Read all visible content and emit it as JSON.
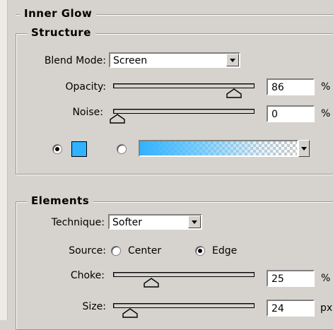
{
  "inner_glow": {
    "title": "Inner Glow",
    "structure": {
      "title": "Structure",
      "blend_mode_label": "Blend Mode:",
      "blend_mode_value": "Screen",
      "opacity_label": "Opacity:",
      "opacity_value": "86",
      "opacity_unit": "%",
      "opacity_level": 0.86,
      "noise_label": "Noise:",
      "noise_value": "0",
      "noise_unit": "%",
      "noise_level": 0,
      "color_mode": "solid",
      "solid_color": "#31b2ff",
      "gradient_start_color": "#31b2ff"
    },
    "elements": {
      "title": "Elements",
      "technique_label": "Technique:",
      "technique_value": "Softer",
      "source_label": "Source:",
      "source_center_label": "Center",
      "source_edge_label": "Edge",
      "source_selected": "Edge",
      "choke_label": "Choke:",
      "choke_value": "25",
      "choke_unit": "%",
      "choke_level": 0.25,
      "size_label": "Size:",
      "size_value": "24",
      "size_unit": "px",
      "size_level": 0.096
    }
  }
}
